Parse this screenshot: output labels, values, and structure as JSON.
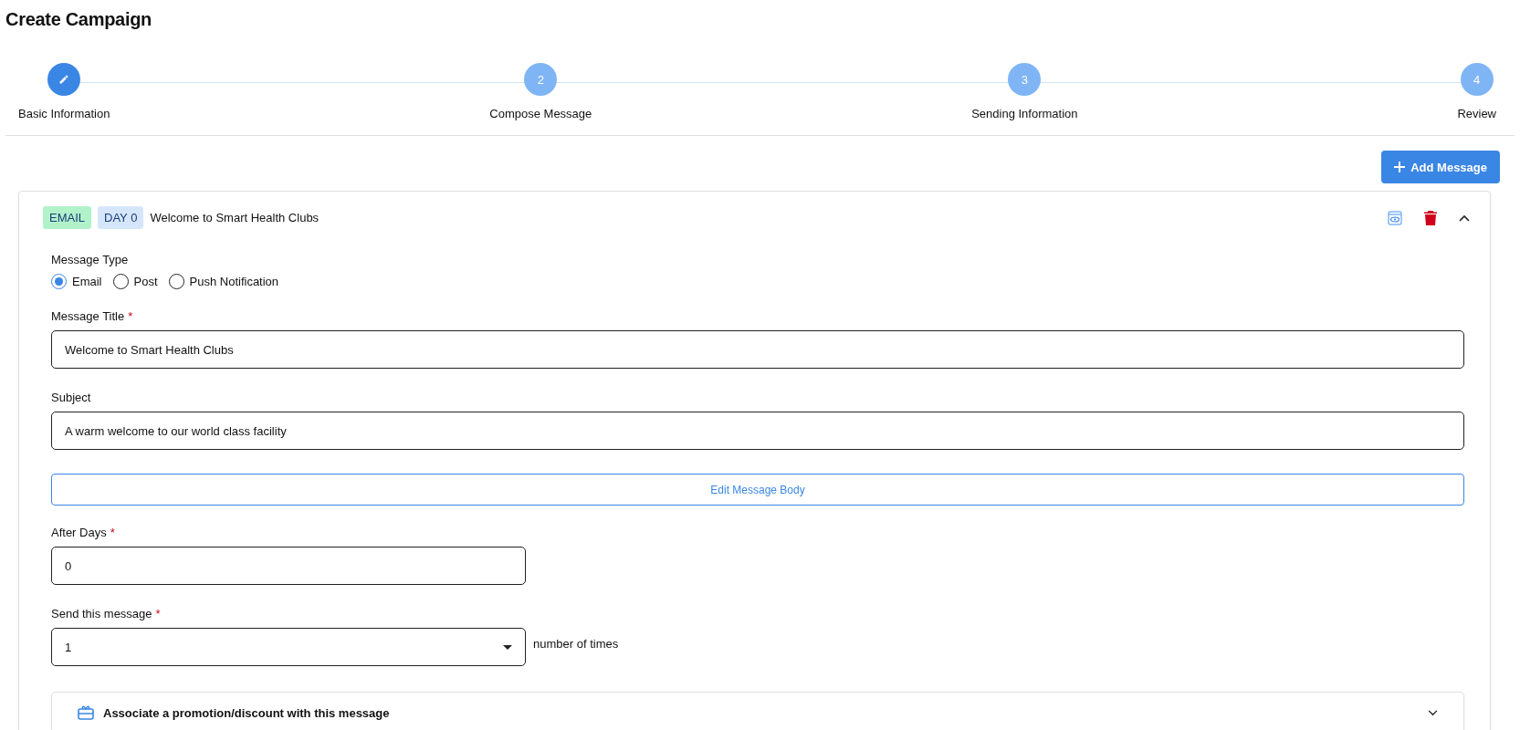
{
  "page": {
    "title": "Create Campaign"
  },
  "steps": [
    {
      "label": "Basic Information",
      "selected": true
    },
    {
      "label": "Compose Message",
      "number": "2",
      "selected": false
    },
    {
      "label": "Sending Information",
      "number": "3",
      "selected": false
    },
    {
      "label": "Review",
      "number": "4",
      "selected": false
    }
  ],
  "add_button": {
    "label": "Add Message"
  },
  "message": {
    "expanded": true,
    "tags": [
      {
        "label": "EMAIL",
        "color": "#b2f2ca"
      },
      {
        "label": "DAY 0",
        "color": "#d6e6fa"
      }
    ],
    "title": "Welcome to Smart Health Clubs",
    "type_label": "Message Type",
    "types": [
      {
        "label": "Email",
        "selected": true
      },
      {
        "label": "Post",
        "selected": false
      },
      {
        "label": "Push Notification",
        "selected": false
      }
    ],
    "title_field": {
      "label": "Message Title",
      "required_mark": "*",
      "value": "Welcome to Smart Health Clubs"
    },
    "subject_field": {
      "label": "Subject",
      "value": "A warm welcome to our world class facility"
    },
    "edit_body_button": "Edit Message Body",
    "after_days_field": {
      "label": "After Days",
      "required_mark": "*",
      "value": "0"
    },
    "send_field": {
      "label": "Send this message",
      "required_mark": "*",
      "value": "1",
      "suffix": "number of times"
    },
    "promotion": {
      "label": "Associate a promotion/discount with this message",
      "expanded": false
    }
  }
}
